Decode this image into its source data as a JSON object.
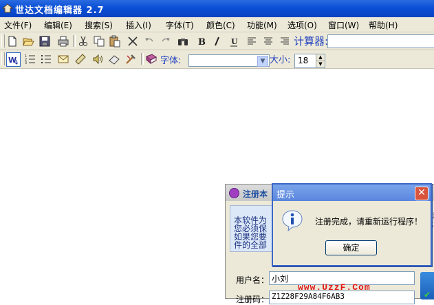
{
  "window": {
    "title": "世达文档编辑器 2.7",
    "menu": [
      {
        "label": "文件(F)",
        "name": "menu-file"
      },
      {
        "label": "编辑(E)",
        "name": "menu-edit"
      },
      {
        "label": "搜索(S)",
        "name": "menu-search"
      },
      {
        "label": "插入(I)",
        "name": "menu-insert"
      },
      {
        "label": "字体(T)",
        "name": "menu-font"
      },
      {
        "label": "颜色(C)",
        "name": "menu-color"
      },
      {
        "label": "功能(M)",
        "name": "menu-function"
      },
      {
        "label": "选项(O)",
        "name": "menu-options"
      },
      {
        "label": "窗口(W)",
        "name": "menu-window"
      },
      {
        "label": "帮助(H)",
        "name": "menu-help"
      }
    ]
  },
  "toolbar": {
    "calc_label": "计算器:",
    "calc_value": "",
    "font_label": "字体:",
    "font_value": "",
    "size_label": "大小:",
    "size_value": "18"
  },
  "register_window": {
    "title": "注册本",
    "info_lines": [
      "本软件为",
      "您必须保",
      "如果您要",
      "件的全部"
    ],
    "side_text": "请\n；",
    "username_label": "用户名：",
    "username_value": "小刘",
    "code_label": "注册码：",
    "code_value": "Z1Z28F29A84F6AB3",
    "watermark": "www.UzzF.Com"
  },
  "dialog": {
    "title": "提示",
    "message": "注册完成，请重新运行程序！",
    "ok_label": "确定",
    "close_symbol": "✕"
  },
  "colors": {
    "title_bar": "#0a4fd6",
    "toolbar_bg": "#ece9d8",
    "label_blue": "#2040c0",
    "watermark_red": "#e01818"
  }
}
